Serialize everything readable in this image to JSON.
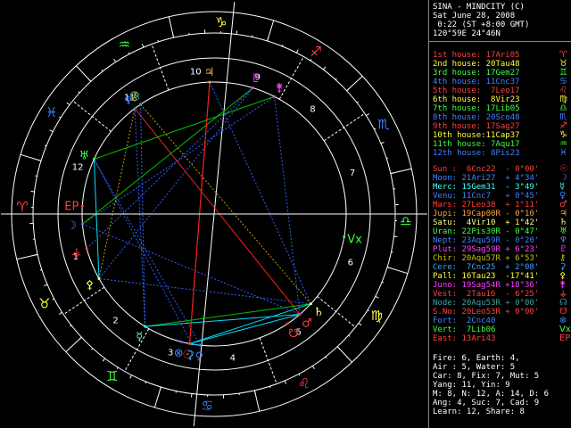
{
  "colors": {
    "ring": "#ffffff",
    "aspect_square": "#00c000",
    "aspect_trine": "#3060ff",
    "aspect_opposition": "#ff2020",
    "aspect_sextile": "#00e0ff",
    "aspect_minor": "#00ffff",
    "aspect_quincunx": "#c0a000"
  },
  "header": {
    "title": "SINA - MINDCITY (C)",
    "date": "Sat June 28, 2008",
    "time": " 0:22 (ST +8:00 GMT)",
    "location": "120°59E 24°46N"
  },
  "houses": [
    {
      "label": "1st house:",
      "value": "17Ari05",
      "sym": "♈",
      "color": "#ff4040"
    },
    {
      "label": "2nd house:",
      "value": "20Tau48",
      "sym": "♉",
      "color": "#ffff40"
    },
    {
      "label": "3rd house:",
      "value": "17Gem27",
      "sym": "♊",
      "color": "#40ff40"
    },
    {
      "label": "4th house:",
      "value": "11Cnc37",
      "sym": "♋",
      "color": "#4080ff"
    },
    {
      "label": "5th house:",
      "value": " 7Leo17",
      "sym": "♌",
      "color": "#ff4040"
    },
    {
      "label": "6th house:",
      "value": " 8Vir23",
      "sym": "♍",
      "color": "#ffff40"
    },
    {
      "label": "7th house:",
      "value": "17Lib05",
      "sym": "♎",
      "color": "#40ff40"
    },
    {
      "label": "8th house:",
      "value": "20Sco48",
      "sym": "♏",
      "color": "#4080ff"
    },
    {
      "label": "9th house:",
      "value": "17Sag27",
      "sym": "♐",
      "color": "#ff4040"
    },
    {
      "label": "10th house:",
      "value": "11Cap37",
      "sym": "♑",
      "color": "#ffff40"
    },
    {
      "label": "11th house:",
      "value": " 7Aqu17",
      "sym": "♒",
      "color": "#40ff40"
    },
    {
      "label": "12th house:",
      "value": " 8Pis23",
      "sym": "♓",
      "color": "#4080ff"
    }
  ],
  "planets": [
    {
      "name": "Sun :",
      "value": " 6Cnc22",
      "aspect": "- 0°00'",
      "sym": "☉",
      "color": "#ff4040"
    },
    {
      "name": "Moon:",
      "value": "21Ari27",
      "aspect": "+ 4°34'",
      "sym": "☽",
      "color": "#4080ff"
    },
    {
      "name": "Merc:",
      "value": "15Gem31",
      "aspect": "- 3°49'",
      "sym": "☿",
      "color": "#40ffff"
    },
    {
      "name": "Venu:",
      "value": "11Cnc7",
      "aspect": "+ 0°45'",
      "sym": "♀",
      "color": "#4080ff"
    },
    {
      "name": "Mars:",
      "value": "27Leo38",
      "aspect": "+ 1°11'",
      "sym": "♂",
      "color": "#ff4040"
    },
    {
      "name": "Jupi:",
      "value": "19Cap00R",
      "aspect": "- 0°10'",
      "sym": "♃",
      "color": "#ffa040"
    },
    {
      "name": "Satu:",
      "value": " 4Vir10",
      "aspect": "+ 1°42'",
      "sym": "♄",
      "color": "#ffff80"
    },
    {
      "name": "Uran:",
      "value": "22Pis30R",
      "aspect": "- 0°47'",
      "sym": "♅",
      "color": "#40ff40"
    },
    {
      "name": "Nept:",
      "value": "23Aqu59R",
      "aspect": "- 0°20'",
      "sym": "♆",
      "color": "#4080ff"
    },
    {
      "name": "Plut:",
      "value": "29Sag59R",
      "aspect": "+ 6°23'",
      "sym": "♇",
      "color": "#ff40ff"
    },
    {
      "name": "Chir:",
      "value": "20Aqu57R",
      "aspect": "+ 6°53'",
      "sym": "⚷",
      "color": "#c0c000"
    },
    {
      "name": "Cere:",
      "value": " 7Cnc25",
      "aspect": "+ 2°08'",
      "sym": "⚳",
      "color": "#40a0ff"
    },
    {
      "name": "Pall:",
      "value": "16Tau23",
      "aspect": "-17°41'",
      "sym": "⚴",
      "color": "#ffff40"
    },
    {
      "name": "Juno:",
      "value": "19Sag54R",
      "aspect": "+18°36'",
      "sym": "⚵",
      "color": "#ff40ff"
    },
    {
      "name": "Vest:",
      "value": " 2Tau16",
      "aspect": "- 6°25'",
      "sym": "⚶",
      "color": "#ff4040"
    },
    {
      "name": "Node:",
      "value": "20Aqu53R",
      "aspect": "+ 0°00'",
      "sym": "☊",
      "color": "#40a0a0"
    },
    {
      "name": "S.No:",
      "value": "20Leo53R",
      "aspect": "+ 0°00'",
      "sym": "☋",
      "color": "#ff4040"
    },
    {
      "name": "Fort:",
      "value": " 2Cnc40",
      "aspect": "",
      "sym": "⊗",
      "color": "#4080ff"
    },
    {
      "name": "Vert:",
      "value": " 7Lib06",
      "aspect": "",
      "sym": "Vx",
      "color": "#40ff40"
    },
    {
      "name": "East:",
      "value": "13Ari43",
      "aspect": "",
      "sym": "EP",
      "color": "#ff4040"
    }
  ],
  "stats": [
    "Fire: 6, Earth: 4,",
    "Air : 5, Water: 5",
    "Car: 8, Fix: 7, Mut: 5",
    "Yang: 11, Yin: 9",
    "M: 8, N: 12, A: 14, D: 6",
    "Ang: 4, Suc: 7, Cad: 9",
    "Learn: 12, Share: 8"
  ],
  "wheel": {
    "signs": [
      {
        "sym": "♈",
        "color": "#ff4040"
      },
      {
        "sym": "♉",
        "color": "#ffff40"
      },
      {
        "sym": "♊",
        "color": "#40ff40"
      },
      {
        "sym": "♋",
        "color": "#4080ff"
      },
      {
        "sym": "♌",
        "color": "#ff4040"
      },
      {
        "sym": "♍",
        "color": "#ffff40"
      },
      {
        "sym": "♎",
        "color": "#40ff40"
      },
      {
        "sym": "♏",
        "color": "#4080ff"
      },
      {
        "sym": "♐",
        "color": "#ff4040"
      },
      {
        "sym": "♑",
        "color": "#ffff40"
      },
      {
        "sym": "♒",
        "color": "#40ff40"
      },
      {
        "sym": "♓",
        "color": "#4080ff"
      }
    ],
    "house_numbers": [
      "1",
      "2",
      "3",
      "4",
      "5",
      "6",
      "7",
      "8",
      "9",
      "10",
      "11",
      "12"
    ]
  }
}
